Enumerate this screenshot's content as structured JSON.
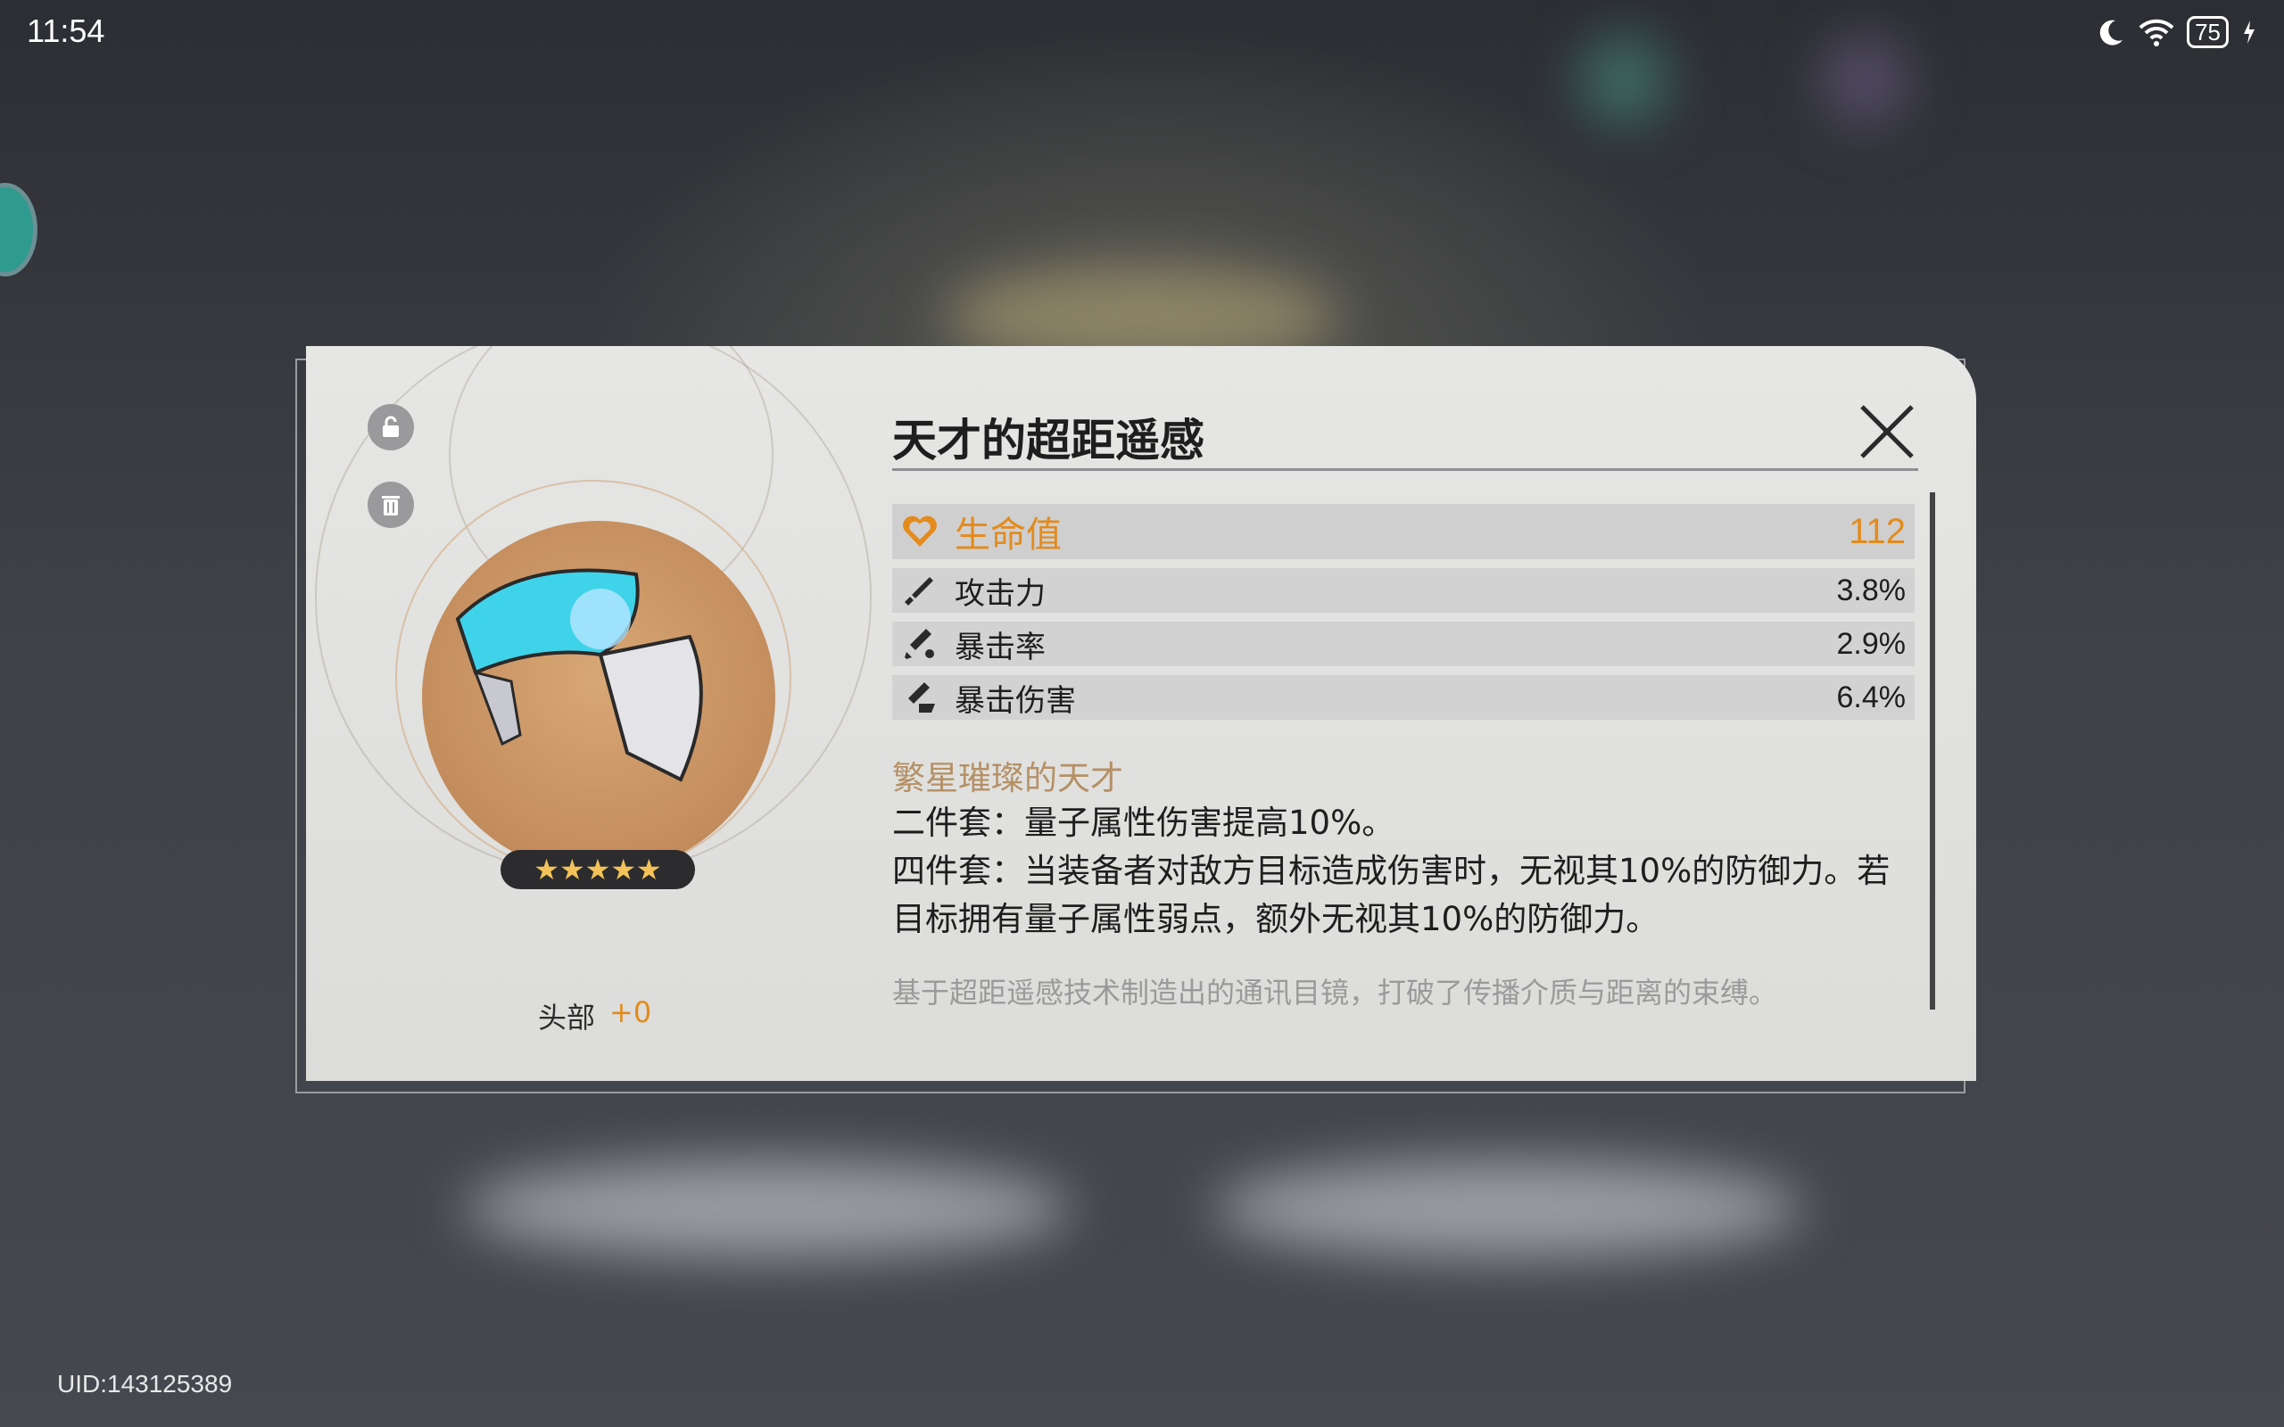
{
  "status_bar": {
    "time": "11:54",
    "battery": "75"
  },
  "uid": "UID:143125389",
  "relic": {
    "name": "天才的超距遥感",
    "slot": "头部",
    "level": "+0",
    "rarity_stars": "★★★★★",
    "main_stat": {
      "name": "生命值",
      "value": "112",
      "icon": "heart-icon"
    },
    "sub_stats": [
      {
        "name": "攻击力",
        "value": "3.8%",
        "icon": "sword-icon"
      },
      {
        "name": "暴击率",
        "value": "2.9%",
        "icon": "crit-rate-icon"
      },
      {
        "name": "暴击伤害",
        "value": "6.4%",
        "icon": "crit-dmg-icon"
      }
    ],
    "set_name": "繁星璀璨的天才",
    "set_bonus_2": "二件套：量子属性伤害提高10%。",
    "set_bonus_4": "四件套：当装备者对敌方目标造成伤害时，无视其10%的防御力。若目标拥有量子属性弱点，额外无视其10%的防御力。",
    "lore": "基于超距遥感技术制造出的通讯目镜，打破了传播介质与距离的束缚。"
  },
  "colors": {
    "accent": "#e38b1c",
    "set_name": "#b59066",
    "lore": "#9a9a9a"
  }
}
